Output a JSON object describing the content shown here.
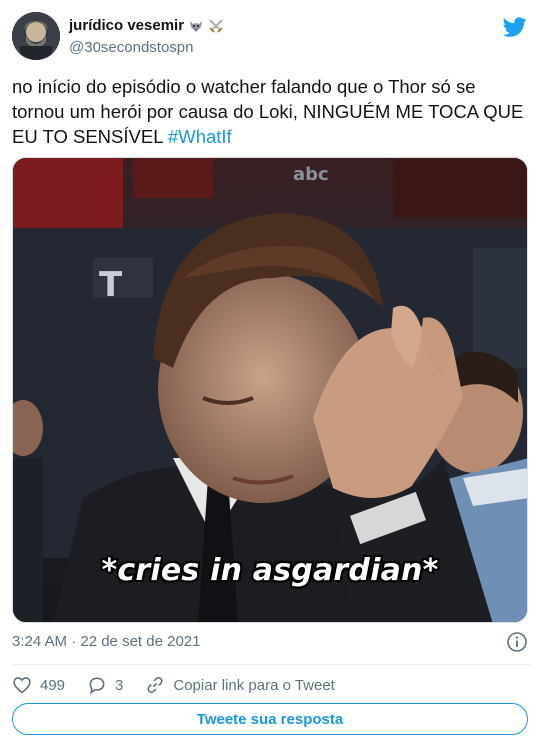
{
  "author": {
    "display_name": "jurídico vesemir",
    "handle": "@30secondstospn"
  },
  "tweet": {
    "text": "no início do episódio o watcher falando que o Thor só se tornou um herói por causa do Loki, NINGUÉM ME TOCA QUE EU TO SENSÍVEL ",
    "hashtag": "#WhatIf"
  },
  "media": {
    "caption": "*cries in asgardian*",
    "backdrop_text": "abc"
  },
  "timestamp": "3:24 AM · 22 de set de 2021",
  "actions": {
    "likes": "499",
    "replies": "3",
    "copy_link": "Copiar link para o Tweet"
  },
  "reply_button": "Tweete sua resposta",
  "colors": {
    "accent": "#1b95e0",
    "muted": "#5b7083",
    "text": "#0f1419"
  }
}
